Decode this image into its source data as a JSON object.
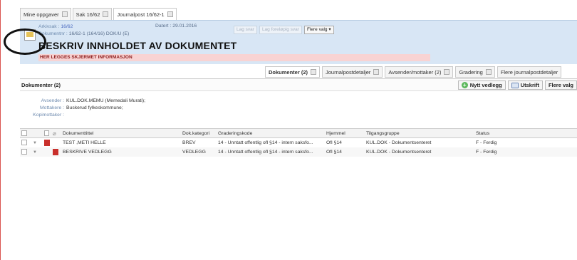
{
  "tabs": [
    {
      "label": "Mine oppgaver"
    },
    {
      "label": "Sak 16/62"
    },
    {
      "label": "Journalpost 16/62-1"
    }
  ],
  "header": {
    "arkivsak_label": "Arkivsak :",
    "arkivsak_value": "16/62",
    "dokument_label": "Dokumentnr :",
    "dokument_value": "16/62-1 (164/16) DOK/U (E)",
    "dato_label": "Datert :",
    "dato_value": "29.01.2016",
    "buttons": [
      "Lag svar",
      "Lag foreløpig svar",
      "Flere valg ▾"
    ],
    "title": "BESKRIV INNHOLDET AV DOKUMENTET",
    "subtitle": "HER LEGGES SKJERMET INFORMASJON"
  },
  "subtabs": [
    {
      "label": "Dokumenter (2)"
    },
    {
      "label": "Journalpostdetaljer"
    },
    {
      "label": "Avsender/mottaker (2)"
    },
    {
      "label": "Gradering"
    },
    {
      "label": "Flere journalpostdetaljer"
    }
  ],
  "section": {
    "title": "Dokumenter (2)",
    "btn_new": "Nytt vedlegg",
    "btn_print": "Utskrift",
    "btn_more": "Flere valg"
  },
  "parties": {
    "avsender_label": "Avsender :",
    "avsender_value": "KUL.DOK.MEMU (Memedali Murati);",
    "mottakere_label": "Mottakere :",
    "mottakere_value": "Buskerud fylkeskommune;",
    "kopi_label": "Kopimottaker :"
  },
  "grid": {
    "columns": [
      "Dokumenttittel",
      "Dok.kategori",
      "Graderingskode",
      "Hjemmel",
      "Tilgangsgruppe",
      "Status"
    ],
    "rows": [
      [
        "TEST ,METI HELLE",
        "BREV",
        "14 - Unntatt offentlig ofl §14 - intern saksfo...",
        "Ofl §14",
        "KUL.DOK - Dokumentsenteret",
        "F - Ferdig"
      ],
      [
        "BESKRIVE VEDLEGG",
        "VEDLEGG",
        "14 - Unntatt offentlig ofl §14 - intern saksfo...",
        "Ofl §14",
        "KUL.DOK - Dokumentsenteret",
        "F - Ferdig"
      ]
    ]
  }
}
